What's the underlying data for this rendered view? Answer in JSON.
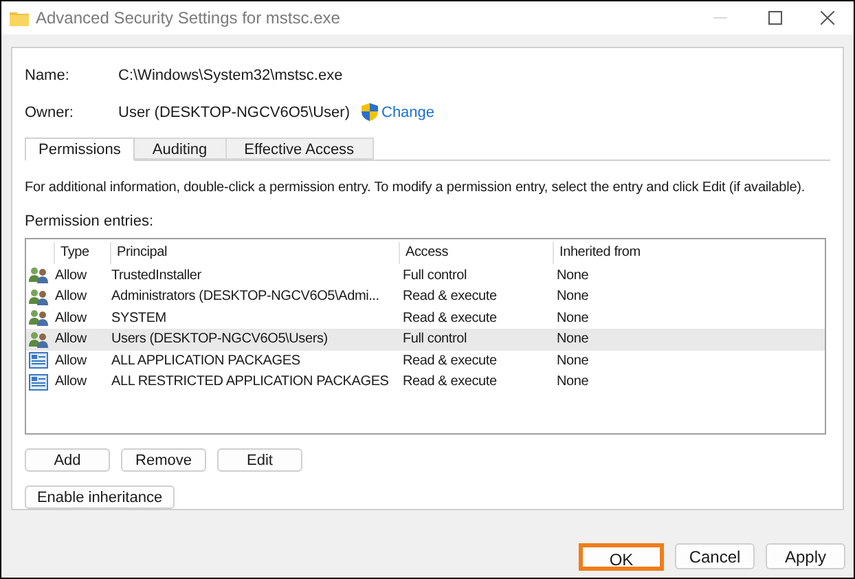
{
  "window": {
    "title": "Advanced Security Settings for mstsc.exe"
  },
  "fields": [
    {
      "label": "Name:",
      "value": "C:\\Windows\\System32\\mstsc.exe"
    },
    {
      "label": "Owner:",
      "value": "User (DESKTOP-NGCV6O5\\User)",
      "link": "Change"
    }
  ],
  "tabs": [
    {
      "label": "Permissions",
      "selected": true
    },
    {
      "label": "Auditing",
      "selected": false
    },
    {
      "label": "Effective Access",
      "selected": false
    }
  ],
  "info": "For additional information, double-click a permission entry. To modify a permission entry, select the entry and click Edit (if available).",
  "list_label": "Permission entries:",
  "table": {
    "columns": [
      "Type",
      "Principal",
      "Access",
      "Inherited from"
    ],
    "rows": [
      {
        "kind": "group",
        "type": "Allow",
        "principal": "TrustedInstaller",
        "access": "Full control",
        "inherited": "None",
        "selected": false
      },
      {
        "kind": "group",
        "type": "Allow",
        "principal": "Administrators (DESKTOP-NGCV6O5\\Admi...",
        "access": "Read & execute",
        "inherited": "None",
        "selected": false
      },
      {
        "kind": "group",
        "type": "Allow",
        "principal": "SYSTEM",
        "access": "Read & execute",
        "inherited": "None",
        "selected": false
      },
      {
        "kind": "group",
        "type": "Allow",
        "principal": "Users (DESKTOP-NGCV6O5\\Users)",
        "access": "Full control",
        "inherited": "None",
        "selected": true
      },
      {
        "kind": "package",
        "type": "Allow",
        "principal": "ALL APPLICATION PACKAGES",
        "access": "Read & execute",
        "inherited": "None",
        "selected": false
      },
      {
        "kind": "package",
        "type": "Allow",
        "principal": "ALL RESTRICTED APPLICATION PACKAGES",
        "access": "Read & execute",
        "inherited": "None",
        "selected": false
      }
    ]
  },
  "list_buttons": [
    "Add",
    "Remove",
    "Edit"
  ],
  "inherit_button": "Enable inheritance",
  "dialog_buttons": [
    {
      "label": "OK",
      "highlighted": true
    },
    {
      "label": "Cancel",
      "highlighted": false
    },
    {
      "label": "Apply",
      "highlighted": false
    }
  ]
}
